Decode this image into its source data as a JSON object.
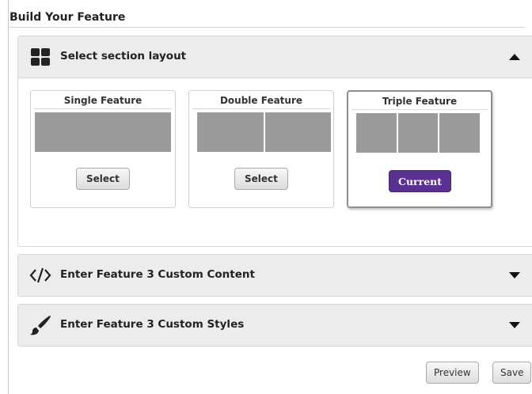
{
  "page": {
    "title": "Build Your Feature"
  },
  "sections": {
    "layout": {
      "label": "Select section layout",
      "icon": "grid-icon",
      "state": "expanded"
    },
    "content": {
      "label": "Enter Feature 3 Custom Content",
      "icon": "code-icon",
      "state": "collapsed"
    },
    "styles": {
      "label": "Enter Feature 3 Custom Styles",
      "icon": "paintbrush-icon",
      "state": "collapsed"
    }
  },
  "layout_options": [
    {
      "title": "Single Feature",
      "columns": 1,
      "button": "Select"
    },
    {
      "title": "Double Feature",
      "columns": 2,
      "button": "Select"
    },
    {
      "title": "Triple Feature",
      "columns": 3,
      "button": "Current"
    }
  ],
  "footer": {
    "preview_label": "Preview",
    "save_label": "Save"
  },
  "colors": {
    "current_button": "#5a3190",
    "preview_block": "#9b9b9b",
    "section_header_bg": "#ececec"
  }
}
